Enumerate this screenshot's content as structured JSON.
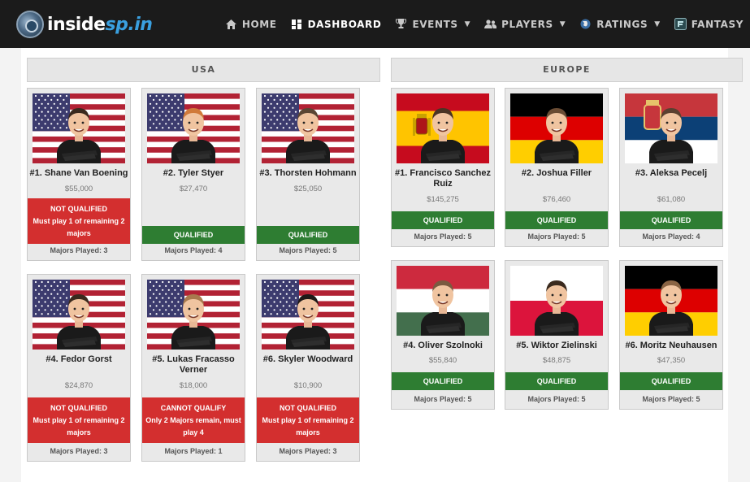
{
  "header": {
    "logo_text_a": "inside",
    "logo_text_b": "sp.in",
    "nav": [
      {
        "label": "HOME",
        "icon": "home-icon",
        "active": false,
        "dropdown": false
      },
      {
        "label": "DASHBOARD",
        "icon": "dashboard-icon",
        "active": true,
        "dropdown": false
      },
      {
        "label": "EVENTS",
        "icon": "trophy-icon",
        "active": false,
        "dropdown": true
      },
      {
        "label": "PLAYERS",
        "icon": "users-icon",
        "active": false,
        "dropdown": true
      },
      {
        "label": "RATINGS",
        "icon": "globe-icon",
        "active": false,
        "dropdown": true
      },
      {
        "label": "FANTASY",
        "icon": "fantasy-icon",
        "active": false,
        "dropdown": false
      }
    ]
  },
  "regions": {
    "usa": {
      "title": "USA",
      "players": [
        {
          "name": "#1. Shane Van Boening",
          "money": "$55,000",
          "status_title": "NOT QUALIFIED",
          "status_detail": "Must play 1 of remaining 2 majors",
          "state": "bad",
          "majors": "Majors Played: 3",
          "flag": "usa"
        },
        {
          "name": "#2. Tyler Styer",
          "money": "$27,470",
          "status_title": "QUALIFIED",
          "status_detail": "",
          "state": "ok",
          "majors": "Majors Played: 4",
          "flag": "usa"
        },
        {
          "name": "#3. Thorsten Hohmann",
          "money": "$25,050",
          "status_title": "QUALIFIED",
          "status_detail": "",
          "state": "ok",
          "majors": "Majors Played: 5",
          "flag": "usa"
        },
        {
          "name": "#4. Fedor Gorst",
          "money": "$24,870",
          "status_title": "NOT QUALIFIED",
          "status_detail": "Must play 1 of remaining 2 majors",
          "state": "bad",
          "majors": "Majors Played: 3",
          "flag": "usa"
        },
        {
          "name": "#5. Lukas Fracasso Verner",
          "money": "$18,000",
          "status_title": "CANNOT QUALIFY",
          "status_detail": "Only 2 Majors remain, must play 4",
          "state": "bad",
          "majors": "Majors Played: 1",
          "flag": "usa"
        },
        {
          "name": "#6. Skyler Woodward",
          "money": "$10,900",
          "status_title": "NOT QUALIFIED",
          "status_detail": "Must play 1 of remaining 2 majors",
          "state": "bad",
          "majors": "Majors Played: 3",
          "flag": "usa"
        }
      ]
    },
    "europe": {
      "title": "EUROPE",
      "players": [
        {
          "name": "#1. Francisco Sanchez Ruiz",
          "money": "$145,275",
          "status_title": "QUALIFIED",
          "status_detail": "",
          "state": "ok",
          "majors": "Majors Played: 5",
          "flag": "spain"
        },
        {
          "name": "#2. Joshua Filler",
          "money": "$76,460",
          "status_title": "QUALIFIED",
          "status_detail": "",
          "state": "ok",
          "majors": "Majors Played: 5",
          "flag": "germany"
        },
        {
          "name": "#3. Aleksa Pecelj",
          "money": "$61,080",
          "status_title": "QUALIFIED",
          "status_detail": "",
          "state": "ok",
          "majors": "Majors Played: 4",
          "flag": "serbia"
        },
        {
          "name": "#4. Oliver Szolnoki",
          "money": "$55,840",
          "status_title": "QUALIFIED",
          "status_detail": "",
          "state": "ok",
          "majors": "Majors Played: 5",
          "flag": "hungary"
        },
        {
          "name": "#5. Wiktor Zielinski",
          "money": "$48,875",
          "status_title": "QUALIFIED",
          "status_detail": "",
          "state": "ok",
          "majors": "Majors Played: 5",
          "flag": "poland"
        },
        {
          "name": "#6. Moritz Neuhausen",
          "money": "$47,350",
          "status_title": "QUALIFIED",
          "status_detail": "",
          "state": "ok",
          "majors": "Majors Played: 5",
          "flag": "germany"
        }
      ]
    }
  },
  "colors": {
    "qualified": "#2e7d32",
    "not_qualified": "#d32f2f",
    "header_bg": "#1b1b1b"
  }
}
